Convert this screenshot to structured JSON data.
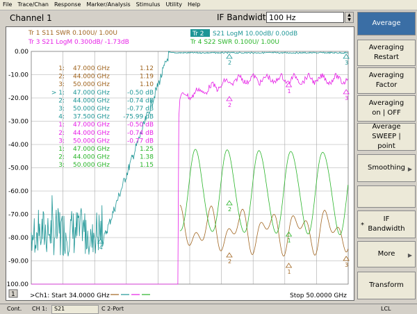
{
  "menu": [
    "File",
    "Trace/Chan",
    "Response",
    "Marker/Analysis",
    "Stimulus",
    "Utility",
    "Help"
  ],
  "toolbar": {
    "channel": "Channel 1",
    "if_label": "IF Bandwidth",
    "if_value": "100 Hz"
  },
  "softkeys": [
    {
      "label": "Average",
      "active": true
    },
    {
      "label": "Averaging Restart"
    },
    {
      "label": "Averaging Factor"
    },
    {
      "label": "Averaging on | OFF"
    },
    {
      "label": "Average SWEEP | point"
    },
    {
      "label": "Smoothing",
      "arrow": true
    },
    {
      "label": ""
    },
    {
      "label": "IF Bandwidth",
      "star": "*"
    },
    {
      "label": "More",
      "arrow": true
    },
    {
      "label": "Transform"
    }
  ],
  "traces": {
    "tr1": "Tr  1  S11 SWR 0.100U/  1.00U",
    "tr2_box": "Tr  2",
    "tr2": "S21 LogM 10.00dB/  0.00dB",
    "tr3": "Tr  3  S21 LogM 0.300dB/  -1.73dB",
    "tr4": "Tr  4  S22 SWR 0.100U/  1.00U"
  },
  "y_ticks": [
    "0.00",
    "-10.00",
    "-20.00",
    "-30.00",
    "-40.00",
    "-50.00",
    "-60.00",
    "-70.00",
    "-80.00",
    "-90.00",
    "-100.00"
  ],
  "markers": [
    {
      "n": "1:",
      "f": "47.000 GHz",
      "v": "1.12",
      "c": "#a0641e"
    },
    {
      "n": "2:",
      "f": "44.000 GHz",
      "v": "1.19",
      "c": "#a0641e"
    },
    {
      "n": "3:",
      "f": "50.000 GHz",
      "v": "1.10",
      "c": "#a0641e"
    },
    {
      "n": "> 1:",
      "f": "47.000 GHz",
      "v": "-0.50 dB",
      "c": "#1e9696"
    },
    {
      "n": "2:",
      "f": "44.000 GHz",
      "v": "-0.74 dB",
      "c": "#1e9696"
    },
    {
      "n": "3:",
      "f": "50.000 GHz",
      "v": "-0.77 dB",
      "c": "#1e9696"
    },
    {
      "n": "4:",
      "f": "37.500 GHz",
      "v": "-75.99 dB",
      "c": "#1e9696"
    },
    {
      "n": "1:",
      "f": "47.000 GHz",
      "v": "-0.50 dB",
      "c": "#e61ee6"
    },
    {
      "n": "2:",
      "f": "44.000 GHz",
      "v": "-0.74 dB",
      "c": "#e61ee6"
    },
    {
      "n": "3:",
      "f": "50.000 GHz",
      "v": "-0.77 dB",
      "c": "#e61ee6"
    },
    {
      "n": "1:",
      "f": "47.000 GHz",
      "v": "1.25",
      "c": "#28b428"
    },
    {
      "n": "2:",
      "f": "44.000 GHz",
      "v": "1.38",
      "c": "#28b428"
    },
    {
      "n": "3:",
      "f": "50.000 GHz",
      "v": "1.15",
      "c": "#28b428"
    }
  ],
  "footer": {
    "num": "1",
    "start": ">Ch1: Start  34.0000 GHz",
    "stop": "Stop  50.0000 GHz"
  },
  "status": {
    "cont": "Cont.",
    "ch": "CH 1:",
    "param": "S21",
    "port": "C  2-Port",
    "lcl": "LCL"
  }
}
